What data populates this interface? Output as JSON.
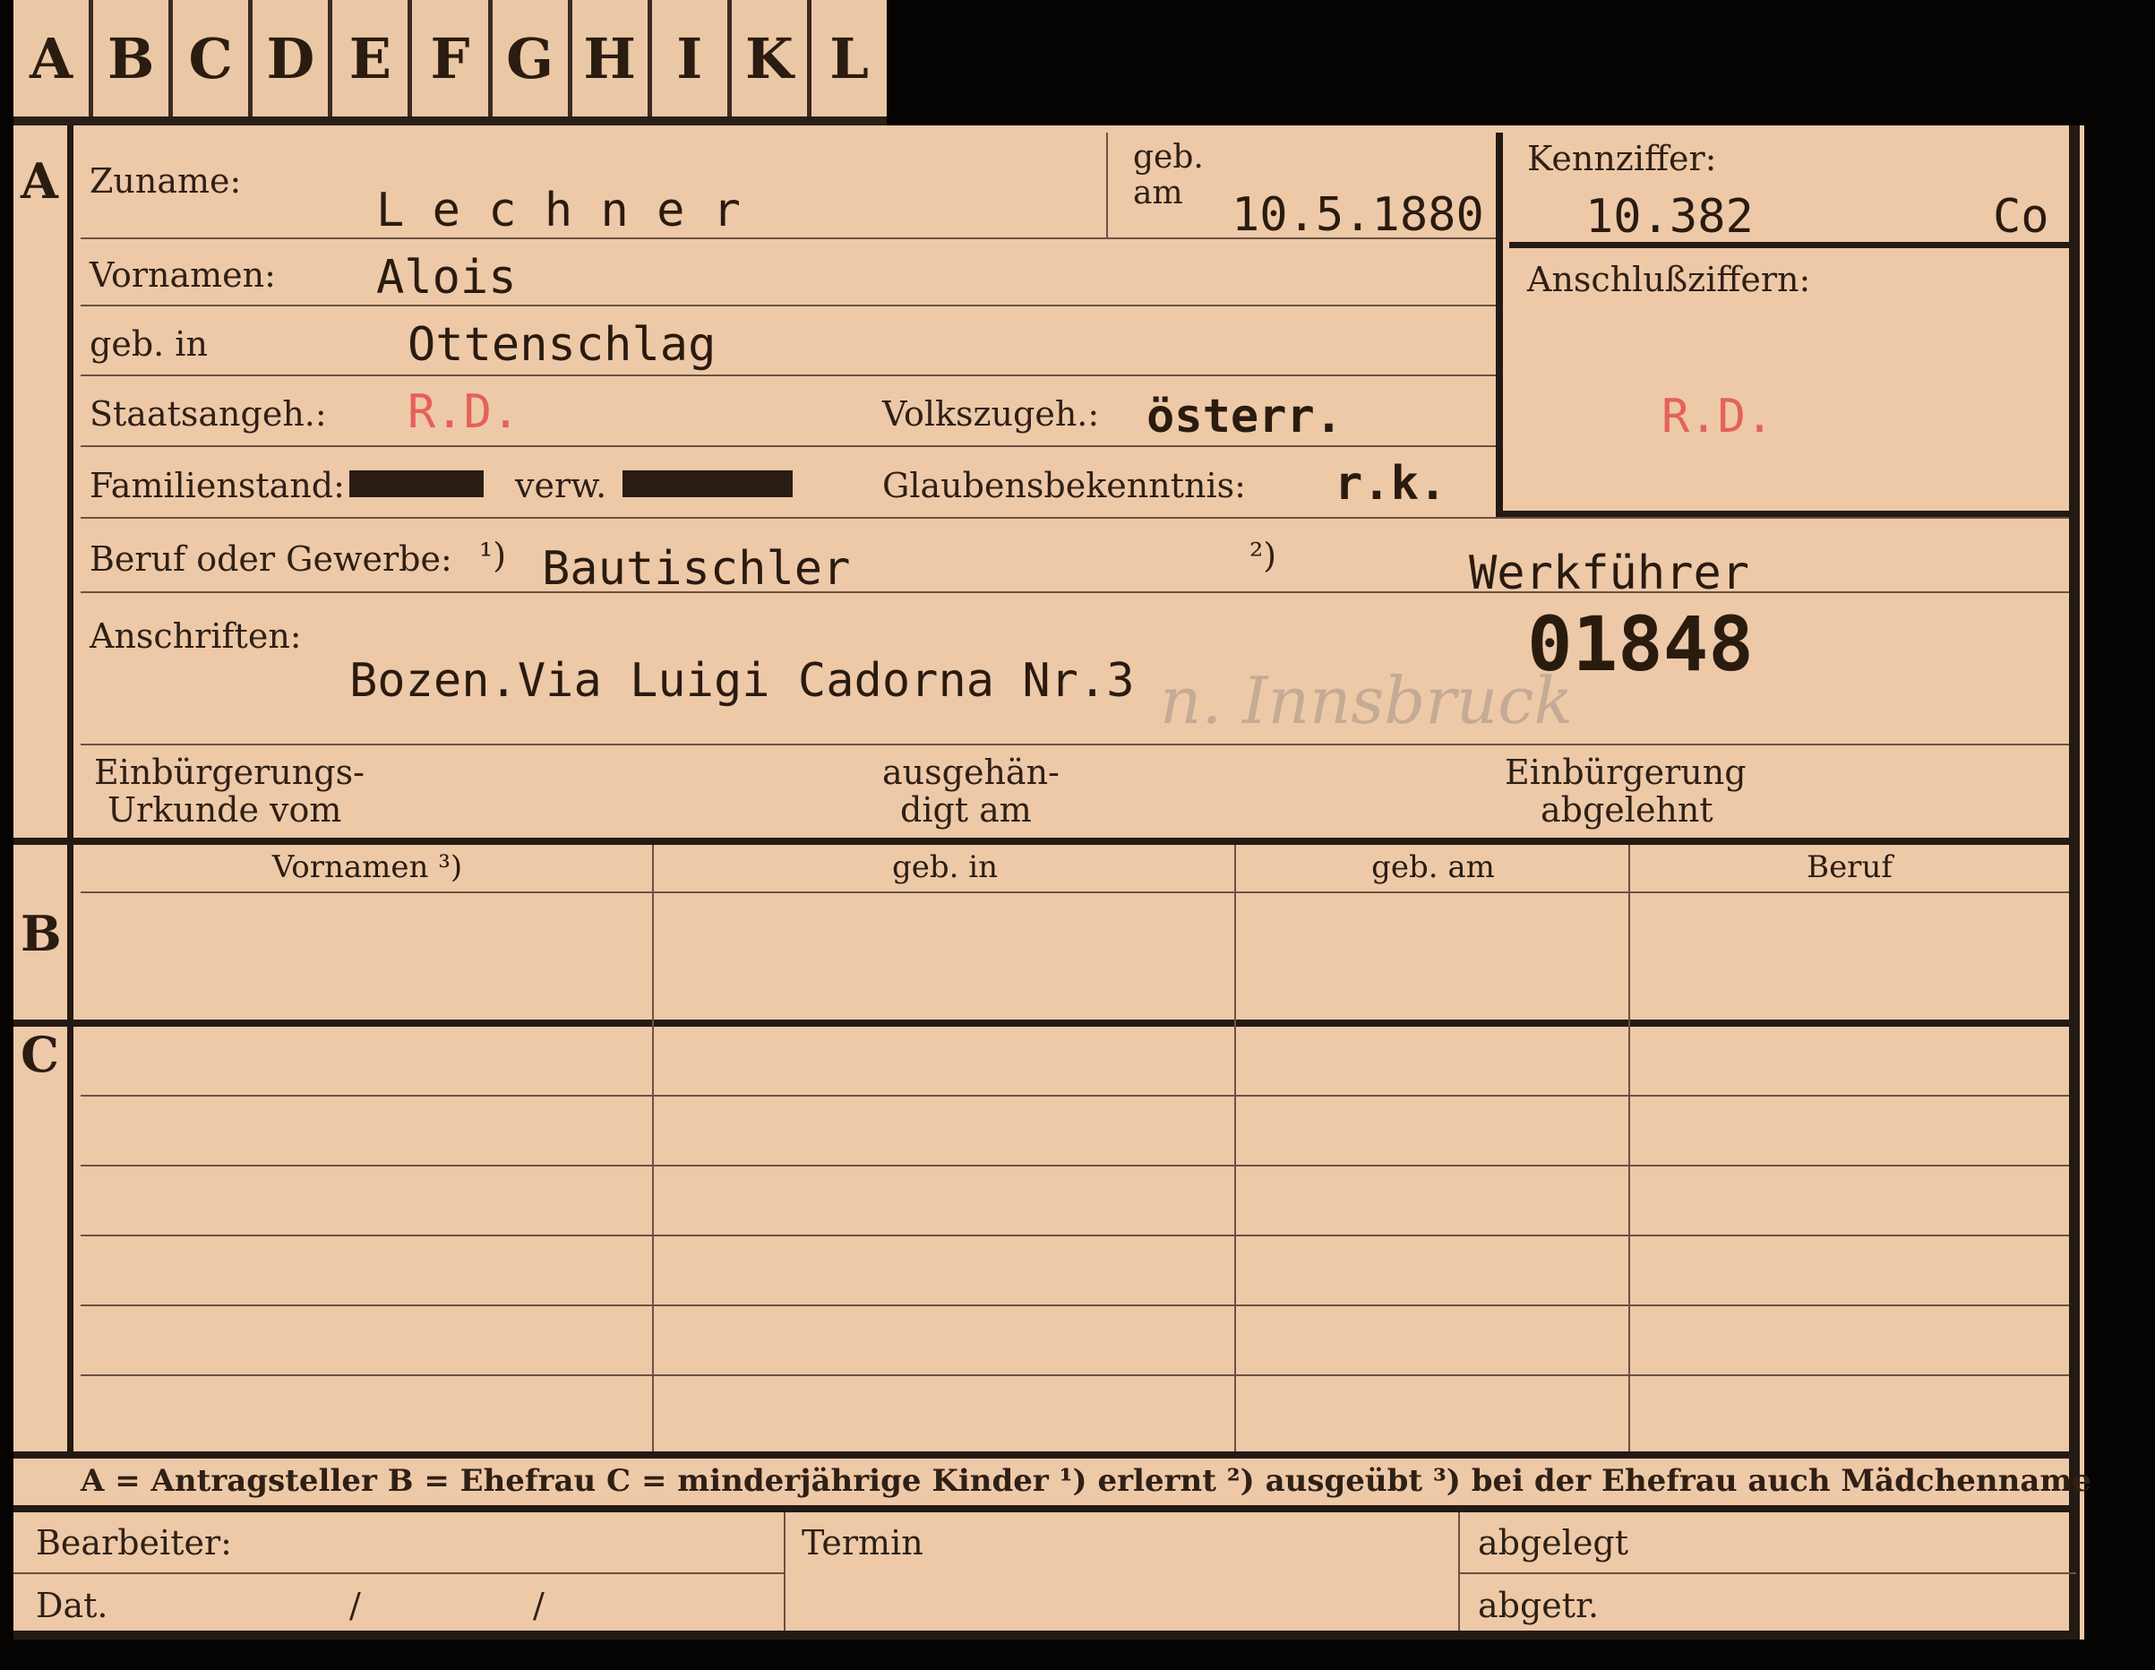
{
  "tabs": [
    "A",
    "B",
    "C",
    "D",
    "E",
    "F",
    "G",
    "H",
    "I",
    "K",
    "L"
  ],
  "sections": {
    "a": "A",
    "b": "B",
    "c": "C"
  },
  "labels": {
    "zuname": "Zuname:",
    "geb_am_1": "geb.",
    "geb_am_2": "am",
    "kennziffer": "Kennziffer:",
    "vornamen": "Vornamen:",
    "anschlussziffern": "Anschlußziffern:",
    "geb_in": "geb. in",
    "staatsangeh": "Staatsangeh.:",
    "volkszugeh": "Volkszugeh.:",
    "familienstand": "Familienstand:",
    "verw": "verw.",
    "glaubensbekenntnis": "Glaubensbekenntnis:",
    "beruf": "Beruf oder Gewerbe:",
    "fn1": "¹)",
    "fn2": "²)",
    "anschriften": "Anschriften:",
    "einbuergerung_urkunde_1": "Einbürgerungs-",
    "einbuergerung_urkunde_2": "Urkunde vom",
    "ausgehaendigt_1": "ausgehän-",
    "ausgehaendigt_2": "digt am",
    "einbuergerung_abgelehnt_1": "Einbürgerung",
    "einbuergerung_abgelehnt_2": "abgelehnt",
    "bearbeiter": "Bearbeiter:",
    "termin": "Termin",
    "abgelegt": "abgelegt",
    "dat": "Dat.",
    "dat_sep1": "/",
    "dat_sep2": "/",
    "abgetr": "abgetr."
  },
  "table_headers": [
    "Vornamen ³)",
    "geb. in",
    "geb. am",
    "Beruf"
  ],
  "legend": "A = Antragsteller   B = Ehefrau   C = minderjährige Kinder   ¹) erlernt   ²) ausgeübt   ³) bei der Ehefrau auch Mädchenname",
  "values": {
    "zuname": "L e c h n e r",
    "geb_am": "10.5.1880",
    "kennziffer": "10.382",
    "kennziffer_suffix": "Co",
    "vornamen": "Alois",
    "geb_in": "Ottenschlag",
    "staatsangeh": "R.D.",
    "anschluss": "R.D.",
    "volkszugeh": "österr.",
    "glaubensbekenntnis": "r.k.",
    "beruf_erlernt": "Bautischler",
    "beruf_ausgeuebt": "Werkführer",
    "stamp_number": "01848",
    "anschrift": "Bozen.Via Luigi Cadorna Nr.3",
    "handwritten": "n. Innsbruck"
  },
  "colors": {
    "card": "#edc9a8",
    "red_stamp": "#e5615a",
    "ink": "#2a1c10"
  }
}
